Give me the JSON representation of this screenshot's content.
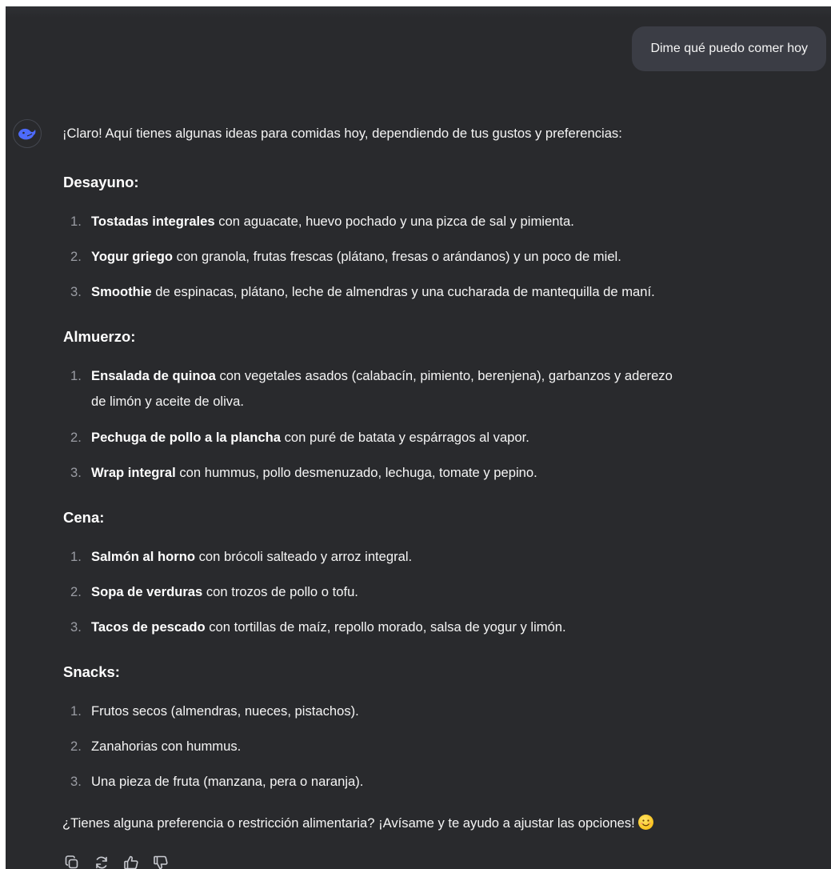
{
  "user_message": "Dime qué puedo comer hoy",
  "assistant": {
    "intro": "¡Claro! Aquí tienes algunas ideas para comidas hoy, dependiendo de tus gustos y preferencias:",
    "sections": [
      {
        "heading": "Desayuno:",
        "items": [
          {
            "num": "1.",
            "bold": "Tostadas integrales",
            "rest": " con aguacate, huevo pochado y una pizca de sal y pimienta."
          },
          {
            "num": "2.",
            "bold": "Yogur griego",
            "rest": " con granola, frutas frescas (plátano, fresas o arándanos) y un poco de miel."
          },
          {
            "num": "3.",
            "bold": "Smoothie",
            "rest": " de espinacas, plátano, leche de almendras y una cucharada de mantequilla de maní."
          }
        ]
      },
      {
        "heading": "Almuerzo:",
        "items": [
          {
            "num": "1.",
            "bold": "Ensalada de quinoa",
            "rest": " con vegetales asados (calabacín, pimiento, berenjena), garbanzos y aderezo",
            "cont": "de limón y aceite de oliva."
          },
          {
            "num": "2.",
            "bold": "Pechuga de pollo a la plancha",
            "rest": " con puré de batata y espárragos al vapor."
          },
          {
            "num": "3.",
            "bold": "Wrap integral",
            "rest": " con hummus, pollo desmenuzado, lechuga, tomate y pepino."
          }
        ]
      },
      {
        "heading": "Cena:",
        "items": [
          {
            "num": "1.",
            "bold": "Salmón al horno",
            "rest": " con brócoli salteado y arroz integral."
          },
          {
            "num": "2.",
            "bold": "Sopa de verduras",
            "rest": " con trozos de pollo o tofu."
          },
          {
            "num": "3.",
            "bold": "Tacos de pescado",
            "rest": " con tortillas de maíz, repollo morado, salsa de yogur y limón."
          }
        ]
      },
      {
        "heading": "Snacks:",
        "items": [
          {
            "num": "1.",
            "bold": "",
            "rest": "Frutos secos (almendras, nueces, pistachos)."
          },
          {
            "num": "2.",
            "bold": "",
            "rest": "Zanahorias con hummus."
          },
          {
            "num": "3.",
            "bold": "",
            "rest": "Una pieza de fruta (manzana, pera o naranja)."
          }
        ]
      }
    ],
    "closing": "¿Tienes alguna preferencia o restricción alimentaria? ¡Avísame y te ayudo a ajustar las opciones!"
  },
  "actions": [
    {
      "name": "copy-icon"
    },
    {
      "name": "regenerate-icon"
    },
    {
      "name": "thumbs-up-icon"
    },
    {
      "name": "thumbs-down-icon"
    }
  ],
  "colors": {
    "background": "#292a2d",
    "user_bubble": "#3b3d45",
    "text": "#f5f5f5",
    "avatar_accent": "#4d6bfe"
  }
}
